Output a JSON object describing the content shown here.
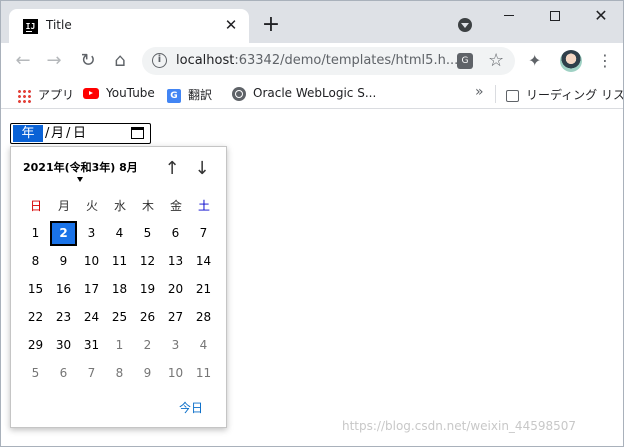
{
  "browser": {
    "tab": {
      "title": "Title",
      "close": "✕"
    },
    "new_tab": "+",
    "url": {
      "host": "localhost",
      "path": ":63342/demo/templates/html5.h..."
    },
    "bookmarks": [
      {
        "label": "アプリ",
        "icon": "apps-icon"
      },
      {
        "label": "YouTube",
        "icon": "youtube-icon"
      },
      {
        "label": "翻訳",
        "icon": "google-translate-icon"
      },
      {
        "label": "Oracle WebLogic S...",
        "icon": "globe-icon"
      }
    ],
    "more": "»",
    "reading_list": "リーディング リスト"
  },
  "date_input": {
    "year_placeholder": "年",
    "month_placeholder": "月",
    "day_placeholder": "日",
    "separator": "/"
  },
  "picker": {
    "month_label": "2021年(令和3年) 8月",
    "weekdays": [
      "日",
      "月",
      "火",
      "水",
      "木",
      "金",
      "土"
    ],
    "weeks": [
      [
        {
          "d": "1",
          "out": false
        },
        {
          "d": "2",
          "out": false,
          "selected": true
        },
        {
          "d": "3",
          "out": false
        },
        {
          "d": "4",
          "out": false
        },
        {
          "d": "5",
          "out": false
        },
        {
          "d": "6",
          "out": false
        },
        {
          "d": "7",
          "out": false
        }
      ],
      [
        {
          "d": "8",
          "out": false
        },
        {
          "d": "9",
          "out": false
        },
        {
          "d": "10",
          "out": false
        },
        {
          "d": "11",
          "out": false
        },
        {
          "d": "12",
          "out": false
        },
        {
          "d": "13",
          "out": false
        },
        {
          "d": "14",
          "out": false
        }
      ],
      [
        {
          "d": "15",
          "out": false
        },
        {
          "d": "16",
          "out": false
        },
        {
          "d": "17",
          "out": false
        },
        {
          "d": "18",
          "out": false
        },
        {
          "d": "19",
          "out": false
        },
        {
          "d": "20",
          "out": false
        },
        {
          "d": "21",
          "out": false
        }
      ],
      [
        {
          "d": "22",
          "out": false
        },
        {
          "d": "23",
          "out": false
        },
        {
          "d": "24",
          "out": false
        },
        {
          "d": "25",
          "out": false
        },
        {
          "d": "26",
          "out": false
        },
        {
          "d": "27",
          "out": false
        },
        {
          "d": "28",
          "out": false
        }
      ],
      [
        {
          "d": "29",
          "out": false
        },
        {
          "d": "30",
          "out": false
        },
        {
          "d": "31",
          "out": false
        },
        {
          "d": "1",
          "out": true
        },
        {
          "d": "2",
          "out": true
        },
        {
          "d": "3",
          "out": true
        },
        {
          "d": "4",
          "out": true
        }
      ],
      [
        {
          "d": "5",
          "out": true
        },
        {
          "d": "6",
          "out": true
        },
        {
          "d": "7",
          "out": true
        },
        {
          "d": "8",
          "out": true
        },
        {
          "d": "9",
          "out": true
        },
        {
          "d": "10",
          "out": true
        },
        {
          "d": "11",
          "out": true
        }
      ]
    ],
    "today_label": "今日"
  },
  "watermark": "https://blog.csdn.net/weixin_44598507",
  "colors": {
    "accent": "#1a73e8",
    "sunday": "#d80000",
    "saturday": "#0000cc",
    "link": "#0a6ec9"
  }
}
